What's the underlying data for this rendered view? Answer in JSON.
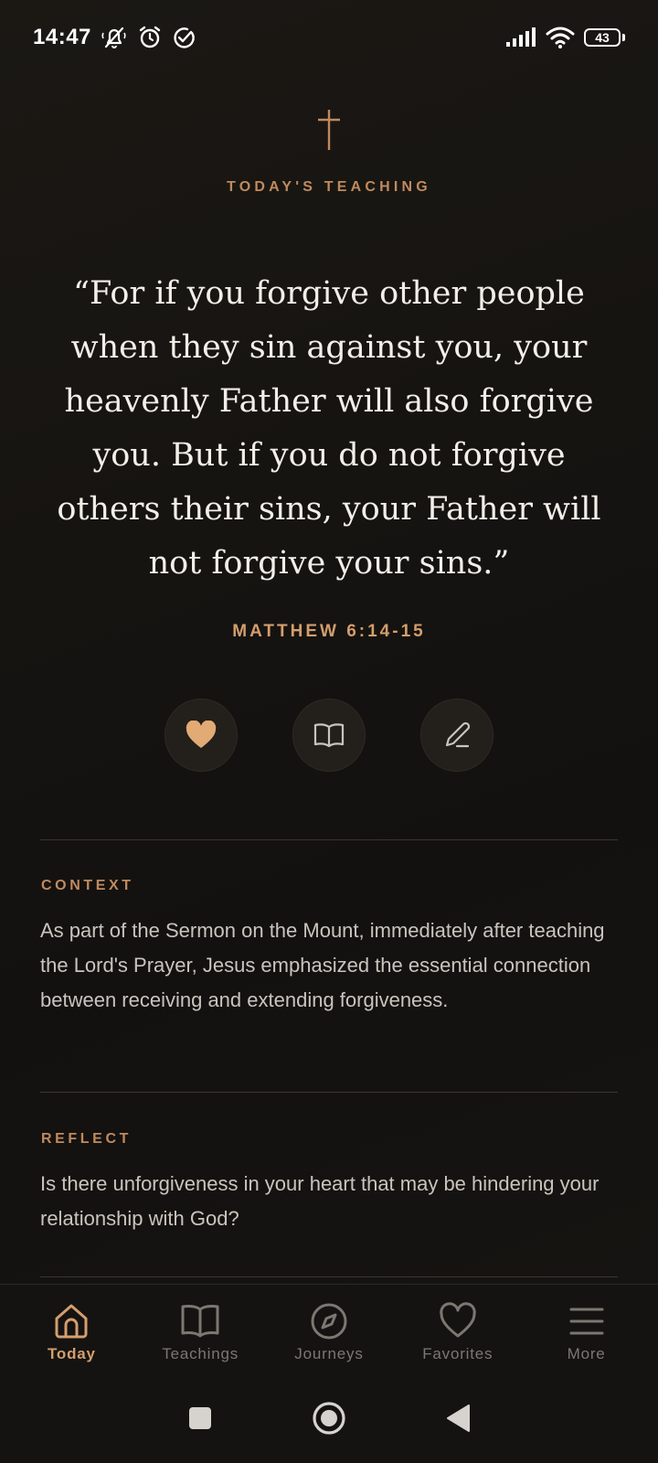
{
  "status_bar": {
    "time": "14:47",
    "battery": "43",
    "icons": [
      "mute-icon",
      "alarm-icon",
      "check-circle-icon",
      "signal-icon",
      "wifi-icon",
      "battery-icon"
    ]
  },
  "hero": {
    "icon": "cross-icon",
    "kicker": "TODAY'S TEACHING",
    "quote": "“For if you forgive other people when they sin against you, your heavenly Father will also forgive you. But if you do not forgive others their sins, your Father will not forgive your sins.”",
    "reference": "MATTHEW 6:14-15"
  },
  "actions": [
    {
      "icon": "heart-icon",
      "state": "filled"
    },
    {
      "icon": "book-icon"
    },
    {
      "icon": "pencil-icon"
    }
  ],
  "context": {
    "label": "CONTEXT",
    "body": "As part of the Sermon on the Mount, immediately after teaching the Lord's Prayer, Jesus emphasized the essential connection between receiving and extending forgiveness."
  },
  "reflect": {
    "label": "REFLECT",
    "body": "Is there unforgiveness in your heart that may be hindering your relationship with God?"
  },
  "bottom_nav": {
    "items": [
      {
        "label": "Today",
        "icon": "home-icon",
        "active": true
      },
      {
        "label": "Teachings",
        "icon": "book-icon"
      },
      {
        "label": "Journeys",
        "icon": "compass-icon"
      },
      {
        "label": "Favorites",
        "icon": "heart-icon"
      },
      {
        "label": "More",
        "icon": "menu-icon"
      }
    ]
  },
  "system_nav": [
    "recents-button",
    "home-button",
    "back-button"
  ],
  "colors": {
    "accent": "#d49e6c",
    "background": "#141210",
    "text": "#f2efe9",
    "muted": "#7c7770"
  }
}
